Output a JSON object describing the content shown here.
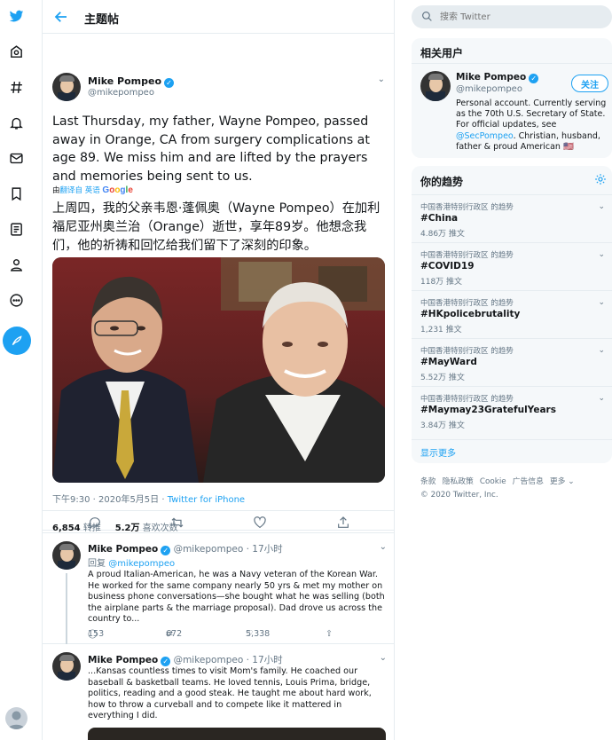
{
  "header": {
    "title": "主题帖"
  },
  "tweet": {
    "name": "Mike Pompeo",
    "handle": "@mikepompeo",
    "text": "Last Thursday, my father, Wayne Pompeo, passed away in Orange, CA from surgery complications at age 89. We miss him and are lifted by the prayers and memories being sent to us.",
    "translate_prefix": "由",
    "translate_link": "翻译自 英语",
    "translate_engine": "Google",
    "translation": "上周四，我的父亲韦恩·蓬佩奥（Wayne Pompeo）在加利福尼亚州奥兰治（Orange）逝世，享年89岁。他想念我们，他的祈祷和回忆给我们留下了深刻的印象。",
    "time": "下午9:30 · 2020年5月5日 · ",
    "source": "Twitter for iPhone",
    "retweets": "6,854",
    "retweets_label": "转推",
    "likes": "5.2万",
    "likes_label": "喜欢次数"
  },
  "replies": [
    {
      "name": "Mike Pompeo",
      "handle": "@mikepompeo",
      "time": "· 17小时",
      "replying_label": "回复",
      "replying_to": "@mikepompeo",
      "text": "A proud Italian-American, he was a Navy veteran of the Korean War. He worked for the same company nearly 50 yrs & met my mother on business phone conversations—she bought what he was selling (both the airplane parts & the marriage proposal). Dad drove us across the country to...",
      "reply_count": "153",
      "retweet_count": "672",
      "like_count": "5,338"
    },
    {
      "name": "Mike Pompeo",
      "handle": "@mikepompeo",
      "time": "· 17小时",
      "text": "...Kansas countless times to visit Mom's family. He coached our baseball & basketball teams. He loved tennis, Louis Prima, bridge, politics, reading and a good steak. He taught me about hard work, how to throw a curveball and to compete like it mattered in everything I did."
    }
  ],
  "search": {
    "placeholder": "搜索 Twitter"
  },
  "related": {
    "title": "相关用户",
    "name": "Mike Pompeo",
    "handle": "@mikepompeo",
    "follow_label": "关注",
    "bio_1": "Personal account. Currently serving as the 70th U.S. Secretary of State. For official updates, see ",
    "bio_link": "@SecPompeo",
    "bio_2": ". Christian, husband, father & proud American 🇺🇸"
  },
  "trends": {
    "title": "你的趋势",
    "items": [
      {
        "context": "中国香港特别行政区 的趋势",
        "tag": "#China",
        "count": "4.86万 推文"
      },
      {
        "context": "中国香港特别行政区 的趋势",
        "tag": "#COVID19",
        "count": "118万 推文"
      },
      {
        "context": "中国香港特别行政区 的趋势",
        "tag": "#HKpolicebrutality",
        "count": "1,231 推文"
      },
      {
        "context": "中国香港特别行政区 的趋势",
        "tag": "#MayWard",
        "count": "5.52万 推文"
      },
      {
        "context": "中国香港特别行政区 的趋势",
        "tag": "#Maymay23GratefulYears",
        "count": "3.84万 推文"
      }
    ],
    "show_more": "显示更多"
  },
  "footer": {
    "links": [
      "条款",
      "隐私政策",
      "Cookie",
      "广告信息",
      "更多 ⌄"
    ],
    "copyright": "© 2020 Twitter, Inc."
  },
  "colors": {
    "accent": "#1da1f2",
    "text": "#14171a",
    "muted": "#657786",
    "panel": "#f5f8fa",
    "border": "#e6ecf0"
  }
}
